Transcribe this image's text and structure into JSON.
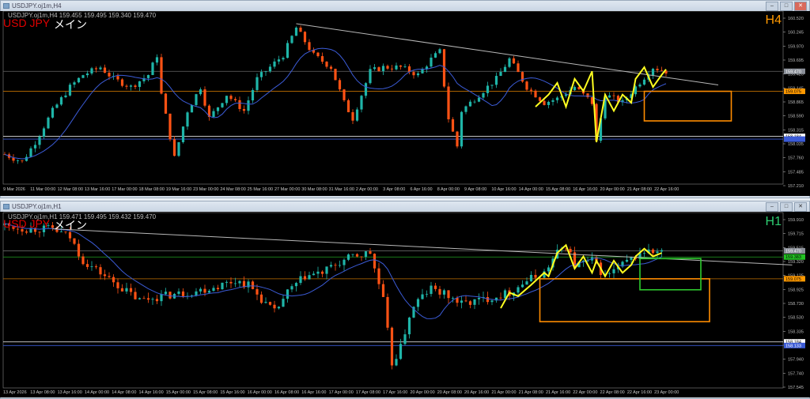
{
  "colors": {
    "bull": "#1fb5a8",
    "bear": "#ff5214",
    "ma": "#3b5bd6",
    "zig": "#ffff20",
    "orange": "#ff8c00",
    "green": "#2ecc2e",
    "trend": "#b8b8b8"
  },
  "top": {
    "window_title": "USDJPY.oj1m,H4",
    "info": "USDJPY.oj1m,H4  159.455 159.495 159.340 159.470",
    "symbol": "USD JPY",
    "label": "メイン",
    "timeframe": "H4",
    "tf_color": "#ff9900",
    "price_axis": [
      "160.520",
      "160.245",
      "159.970",
      "159.695",
      "159.420",
      "159.145",
      "158.865",
      "158.590",
      "158.315",
      "158.035",
      "157.760",
      "157.485",
      "157.210"
    ],
    "price_tags": [
      {
        "text": "159.470",
        "price": 159.47,
        "bg": "#8a8f98",
        "fg": "#fff",
        "line": "#666"
      },
      {
        "text": "159.075",
        "price": 159.075,
        "bg": "#ff9900",
        "fg": "#000",
        "line": "#c07000"
      },
      {
        "text": "158.184",
        "price": 158.184,
        "bg": "#ffffff",
        "fg": "#000",
        "line": "#ffffff"
      },
      {
        "text": "",
        "price": 158.13,
        "bg": "#3b5bd6",
        "fg": "#fff",
        "line": "#3b5bd6"
      }
    ],
    "time_axis": [
      "9 Mar 2026",
      "11 Mar 00:00",
      "12 Mar 08:00",
      "13 Mar 16:00",
      "17 Mar 00:00",
      "18 Mar 08:00",
      "19 Mar 16:00",
      "23 Mar 00:00",
      "24 Mar 08:00",
      "25 Mar 16:00",
      "27 Mar 00:00",
      "30 Mar 08:00",
      "31 Mar 16:00",
      "2 Apr 00:00",
      "3 Apr 08:00",
      "6 Apr 16:00",
      "8 Apr 00:00",
      "9 Apr 08:00",
      "10 Apr 16:00",
      "14 Apr 00:00",
      "15 Apr 08:00",
      "16 Apr 16:00",
      "20 Apr 00:00",
      "21 Apr 08:00",
      "22 Apr 16:00"
    ],
    "path": [
      [
        0,
        157.83
      ],
      [
        4,
        157.68
      ],
      [
        7,
        158.07
      ],
      [
        11,
        158.69
      ],
      [
        15,
        159.16
      ],
      [
        18,
        159.4
      ],
      [
        22,
        159.55
      ],
      [
        25,
        159.32
      ],
      [
        29,
        159.16
      ],
      [
        33,
        159.4
      ],
      [
        35,
        159.79
      ],
      [
        36,
        159.01
      ],
      [
        39,
        157.76
      ],
      [
        42,
        158.69
      ],
      [
        45,
        159.16
      ],
      [
        47,
        158.54
      ],
      [
        51,
        159.01
      ],
      [
        55,
        158.69
      ],
      [
        58,
        159.32
      ],
      [
        64,
        159.79
      ],
      [
        67,
        160.33
      ],
      [
        71,
        159.79
      ],
      [
        75,
        159.55
      ],
      [
        78,
        158.85
      ],
      [
        80,
        158.54
      ],
      [
        84,
        159.47
      ],
      [
        87,
        159.55
      ],
      [
        91,
        159.55
      ],
      [
        95,
        159.4
      ],
      [
        98,
        159.71
      ],
      [
        100,
        159.86
      ],
      [
        102,
        158.54
      ],
      [
        104,
        157.99
      ],
      [
        105,
        158.69
      ],
      [
        109,
        159.01
      ],
      [
        113,
        159.32
      ],
      [
        116,
        159.71
      ],
      [
        120,
        159.16
      ],
      [
        124,
        158.85
      ],
      [
        127,
        158.93
      ],
      [
        131,
        159.16
      ],
      [
        135,
        158.85
      ],
      [
        136,
        158.07
      ],
      [
        138,
        159.01
      ],
      [
        142,
        158.85
      ],
      [
        145,
        159.16
      ],
      [
        149,
        159.55
      ],
      [
        152,
        159.47
      ]
    ],
    "zigzag": [
      [
        122,
        158.77
      ],
      [
        125,
        159.01
      ],
      [
        127,
        159.24
      ],
      [
        129,
        158.77
      ],
      [
        131,
        159.32
      ],
      [
        133,
        159.08
      ],
      [
        135,
        159.47
      ],
      [
        136,
        158.07
      ],
      [
        138,
        159.01
      ],
      [
        140,
        158.69
      ],
      [
        142,
        159.01
      ],
      [
        144,
        158.85
      ],
      [
        145,
        159.32
      ],
      [
        147,
        159.55
      ],
      [
        149,
        159.16
      ],
      [
        151,
        159.4
      ],
      [
        152,
        159.51
      ]
    ],
    "trendline": [
      [
        67,
        160.41
      ],
      [
        164,
        159.2
      ]
    ],
    "rects": [
      {
        "bars": [
          147,
          167
        ],
        "prices": [
          159.075,
          158.49
        ],
        "color": "#ff8c00"
      }
    ]
  },
  "bottom": {
    "window_title": "USDJPY.oj1m,H1",
    "info": "USDJPY.oj1m,H1  159.471 159.495 159.432 159.470",
    "symbol": "USD JPY",
    "label": "メイン",
    "timeframe": "H1",
    "tf_color": "#2ecc71",
    "price_axis": [
      "159.910",
      "159.715",
      "159.515",
      "159.320",
      "159.125",
      "158.925",
      "158.730",
      "158.530",
      "158.335",
      "158.135",
      "157.940",
      "157.740",
      "157.545"
    ],
    "price_tags": [
      {
        "text": "159.470",
        "price": 159.47,
        "bg": "#8a8f98",
        "fg": "#fff",
        "line": "#666"
      },
      {
        "text": "159.383",
        "price": 159.383,
        "bg": "#22c022",
        "fg": "#000",
        "line": "#22a022"
      },
      {
        "text": "159.075",
        "price": 159.075,
        "bg": "#ff9900",
        "fg": "#000",
        "line": "#c07000"
      },
      {
        "text": "158.184",
        "price": 158.184,
        "bg": "#ffffff",
        "fg": "#000",
        "line": "#ffffff"
      },
      {
        "text": "158.133",
        "price": 158.133,
        "bg": "#3b5bd6",
        "fg": "#fff",
        "line": "#3b5bd6"
      }
    ],
    "time_axis": [
      "13 Apr 2026",
      "13 Apr 08:00",
      "13 Apr 16:00",
      "14 Apr 00:00",
      "14 Apr 08:00",
      "14 Apr 16:00",
      "15 Apr 00:00",
      "15 Apr 08:00",
      "15 Apr 16:00",
      "16 Apr 00:00",
      "16 Apr 08:00",
      "16 Apr 16:00",
      "17 Apr 00:00",
      "17 Apr 08:00",
      "17 Apr 16:00",
      "20 Apr 00:00",
      "20 Apr 08:00",
      "20 Apr 16:00",
      "21 Apr 00:00",
      "21 Apr 08:00",
      "21 Apr 16:00",
      "22 Apr 00:00",
      "22 Apr 08:00",
      "22 Apr 16:00",
      "23 Apr 00:00"
    ],
    "path": [
      [
        0,
        159.83
      ],
      [
        5,
        159.78
      ],
      [
        11,
        159.78
      ],
      [
        15,
        159.66
      ],
      [
        18,
        159.33
      ],
      [
        22,
        159.16
      ],
      [
        27,
        158.94
      ],
      [
        31,
        158.77
      ],
      [
        36,
        158.83
      ],
      [
        42,
        158.88
      ],
      [
        47,
        158.94
      ],
      [
        53,
        159.05
      ],
      [
        56,
        158.99
      ],
      [
        60,
        158.72
      ],
      [
        62,
        158.6
      ],
      [
        65,
        158.88
      ],
      [
        69,
        159.11
      ],
      [
        73,
        159.16
      ],
      [
        76,
        159.27
      ],
      [
        80,
        159.39
      ],
      [
        84,
        159.44
      ],
      [
        85,
        159.22
      ],
      [
        87,
        158.77
      ],
      [
        89,
        157.88
      ],
      [
        91,
        158.1
      ],
      [
        93,
        158.55
      ],
      [
        95,
        158.77
      ],
      [
        98,
        158.94
      ],
      [
        102,
        158.83
      ],
      [
        105,
        158.72
      ],
      [
        109,
        158.77
      ],
      [
        113,
        158.83
      ],
      [
        116,
        158.88
      ],
      [
        120,
        159.05
      ],
      [
        124,
        159.16
      ],
      [
        127,
        159.44
      ],
      [
        129,
        159.55
      ],
      [
        131,
        159.27
      ],
      [
        135,
        159.33
      ],
      [
        138,
        159.11
      ],
      [
        142,
        159.27
      ],
      [
        145,
        159.39
      ],
      [
        147,
        159.46
      ],
      [
        151,
        159.44
      ]
    ],
    "zigzag": [
      [
        114,
        158.66
      ],
      [
        116,
        158.88
      ],
      [
        118,
        158.83
      ],
      [
        121,
        158.99
      ],
      [
        124,
        159.16
      ],
      [
        125,
        159.11
      ],
      [
        127,
        159.44
      ],
      [
        129,
        159.55
      ],
      [
        131,
        159.22
      ],
      [
        133,
        159.39
      ],
      [
        135,
        159.16
      ],
      [
        136,
        159.33
      ],
      [
        138,
        159.11
      ],
      [
        140,
        159.33
      ],
      [
        142,
        159.16
      ],
      [
        144,
        159.27
      ],
      [
        145,
        159.39
      ],
      [
        147,
        159.5
      ],
      [
        149,
        159.39
      ],
      [
        151,
        159.44
      ]
    ],
    "trendline": [
      [
        11,
        159.78
      ],
      [
        181,
        159.27
      ]
    ],
    "rects": [
      {
        "bars": [
          123,
          162
        ],
        "prices": [
          159.075,
          158.47
        ],
        "color": "#ff8c00"
      },
      {
        "bars": [
          146,
          160
        ],
        "prices": [
          159.36,
          158.92
        ],
        "color": "#2ecc2e"
      }
    ]
  }
}
